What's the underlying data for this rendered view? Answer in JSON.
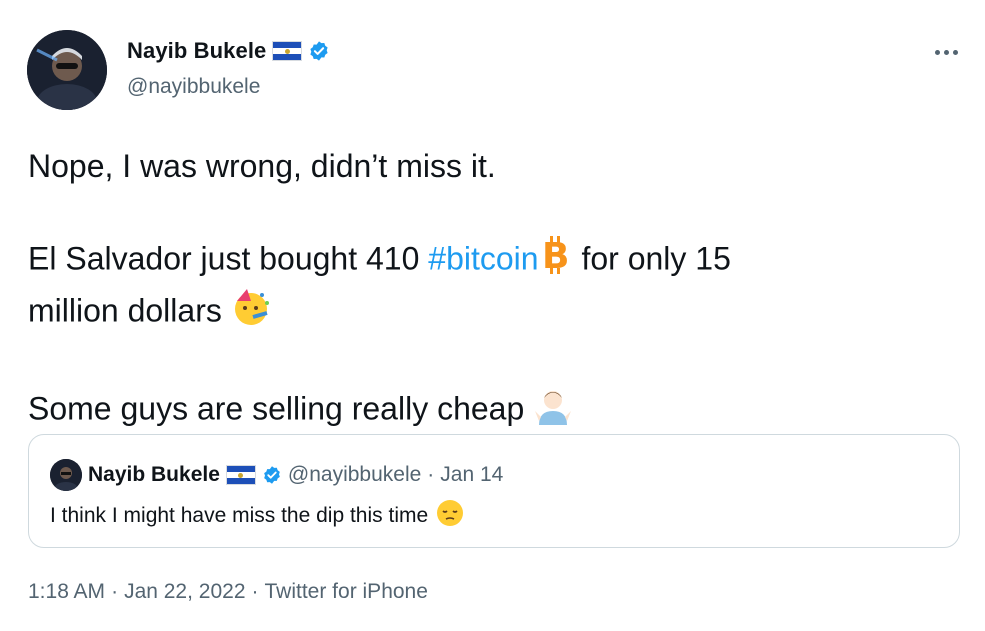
{
  "author": {
    "name": "Nayib Bukele",
    "handle": "@nayibbukele",
    "verified": true,
    "flag": "el-salvador-flag-icon",
    "avatar_icon": "user-avatar"
  },
  "menu": {
    "icon": "more-options-icon"
  },
  "tweet": {
    "line1": "Nope, I was wrong, didn’t miss it.",
    "line2_pre": "El Salvador just bought 410 ",
    "hashtag": "#bitcoin",
    "line2_post": " for only 15",
    "line3": "million dollars ",
    "line4": "Some guys are selling really cheap "
  },
  "quoted": {
    "name": "Nayib Bukele",
    "handle": "@nayibbukele",
    "separator": "·",
    "date": "Jan 14",
    "text": "I think I might have miss the dip this time"
  },
  "footer": {
    "time": "1:18 AM",
    "sep1": "·",
    "date": "Jan 22, 2022",
    "sep2": "·",
    "source": "Twitter for iPhone"
  },
  "colors": {
    "link": "#1d9bf0",
    "secondary": "#536471",
    "text": "#0f1419",
    "border": "#cfd9de"
  }
}
